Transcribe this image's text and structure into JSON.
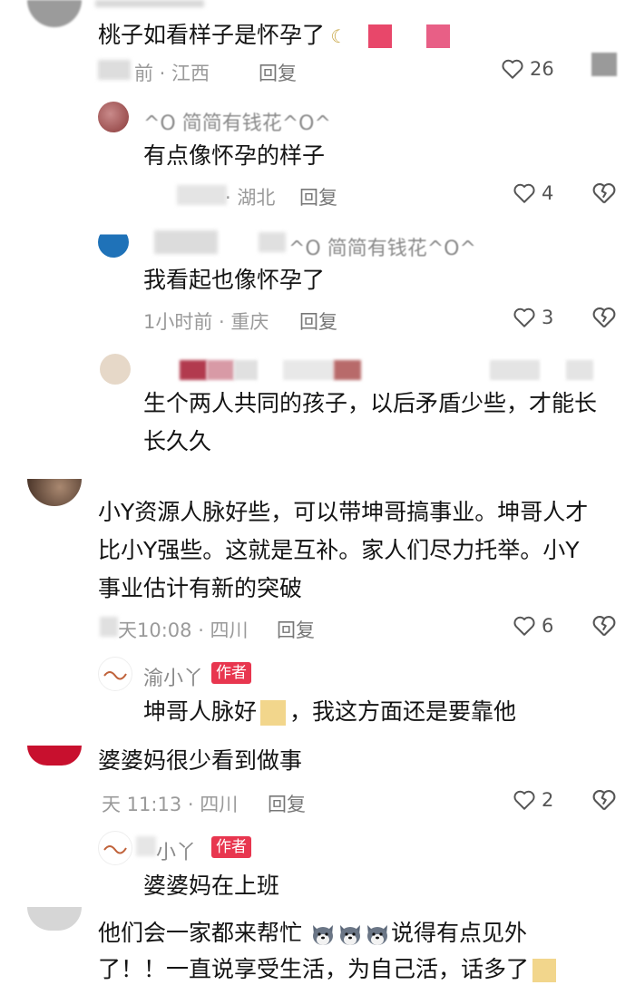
{
  "comments": [
    {
      "text": "桃子如看样子是怀孕了",
      "time": "前 · 江西",
      "reply": "回复",
      "likes": "26"
    },
    {
      "name": "^O 简简有钱花^O^",
      "text": "有点像怀孕的样子",
      "time": "· 湖北",
      "reply": "回复",
      "likes": "4"
    },
    {
      "name": "^O 简简有钱花^O^",
      "text": "我看起也像怀孕了",
      "time": "1小时前 · 重庆",
      "reply": "回复",
      "likes": "3"
    },
    {
      "text_lines": [
        "生个两人共同的孩子，以后矛盾少些，才能长",
        "长久久"
      ]
    },
    {
      "text_lines": [
        "小Y资源人脉好些，可以带坤哥搞事业。坤哥人才",
        "比小Y强些。这就是互补。家人们尽力托举。小Y",
        "事业估计有新的突破"
      ],
      "time": "天10:08 · 四川",
      "reply": "回复",
      "likes": "6"
    },
    {
      "name": "渝小丫",
      "badge": "作者",
      "text_a": "坤哥人脉好",
      "text_b": "，我这方面还是要靠他"
    },
    {
      "text": "婆婆妈很少看到做事",
      "time": "天 11:13 · 四川",
      "reply": "回复",
      "likes": "2"
    },
    {
      "name": "小丫",
      "badge": "作者",
      "text": "婆婆妈在上班"
    },
    {
      "text_a": "他们会一家都来帮忙",
      "text_b": "说得有点见外",
      "text_c": "了！！一直说享受生活，为自己活，话多了"
    }
  ],
  "colors": {
    "badge": "#e8364f",
    "text": "#141414",
    "meta": "#9a9a9a"
  },
  "icons": [
    "heart-outline-icon",
    "broken-heart-icon",
    "husky-emoji-icon"
  ]
}
